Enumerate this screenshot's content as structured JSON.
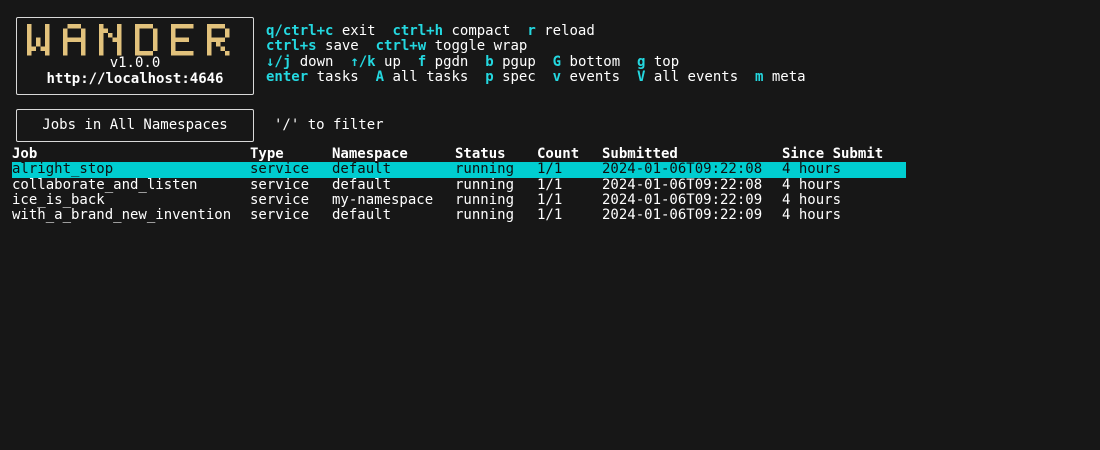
{
  "logo": {
    "title": "WANDER",
    "version": "v1.0.0",
    "url": "http://localhost:4646",
    "color": "#e2c27c"
  },
  "keybindings": [
    [
      {
        "key": "q/ctrl+c",
        "desc": "exit"
      },
      {
        "key": "ctrl+h",
        "desc": "compact"
      },
      {
        "key": "r",
        "desc": "reload"
      }
    ],
    [
      {
        "key": "ctrl+s",
        "desc": "save"
      },
      {
        "key": "ctrl+w",
        "desc": "toggle wrap"
      }
    ],
    [
      {
        "key": "↓/j",
        "desc": "down"
      },
      {
        "key": "↑/k",
        "desc": "up"
      },
      {
        "key": "f",
        "desc": "pgdn"
      },
      {
        "key": "b",
        "desc": "pgup"
      },
      {
        "key": "G",
        "desc": "bottom"
      },
      {
        "key": "g",
        "desc": "top"
      }
    ],
    [
      {
        "key": "enter",
        "desc": "tasks"
      },
      {
        "key": "A",
        "desc": "all tasks"
      },
      {
        "key": "p",
        "desc": "spec"
      },
      {
        "key": "v",
        "desc": "events"
      },
      {
        "key": "V",
        "desc": "all events"
      },
      {
        "key": "m",
        "desc": "meta"
      }
    ]
  ],
  "view_title": "Jobs in All Namespaces",
  "filter_hint": "'/' to filter",
  "table": {
    "columns": [
      "Job",
      "Type",
      "Namespace",
      "Status",
      "Count",
      "Submitted",
      "Since Submit"
    ],
    "rows": [
      [
        "alright_stop",
        "service",
        "default",
        "running",
        "1/1",
        "2024-01-06T09:22:08",
        "4 hours"
      ],
      [
        "collaborate_and_listen",
        "service",
        "default",
        "running",
        "1/1",
        "2024-01-06T09:22:08",
        "4 hours"
      ],
      [
        "ice_is_back",
        "service",
        "my-namespace",
        "running",
        "1/1",
        "2024-01-06T09:22:09",
        "4 hours"
      ],
      [
        "with_a_brand_new_invention",
        "service",
        "default",
        "running",
        "1/1",
        "2024-01-06T09:22:09",
        "4 hours"
      ]
    ],
    "selected_row": 0
  },
  "colors": {
    "background": "#171717",
    "key": "#24d8e0",
    "selection": "#00cdd0",
    "logo": "#e2c27c"
  }
}
